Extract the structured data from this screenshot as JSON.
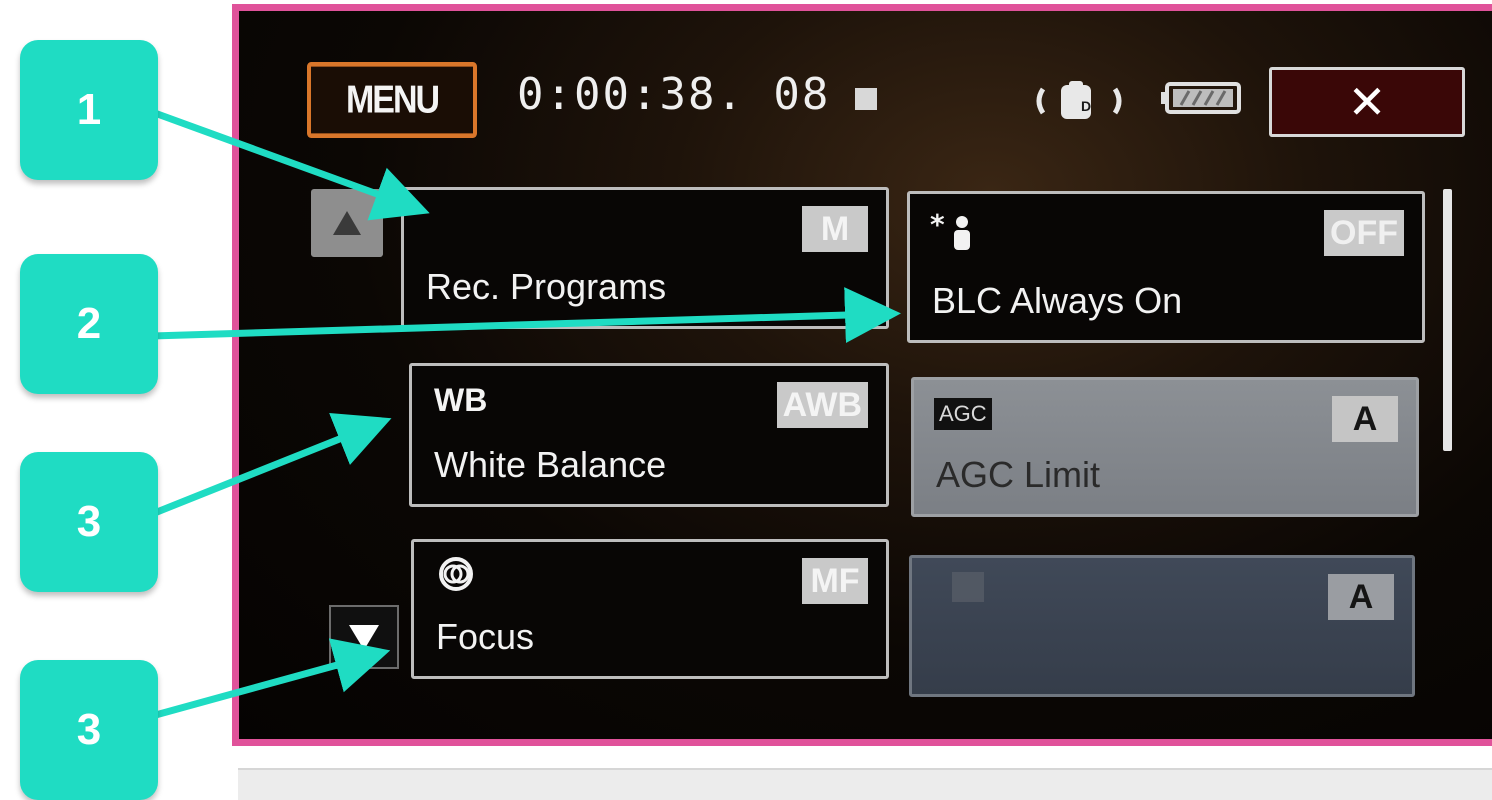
{
  "header": {
    "menu_label": "MENU",
    "timecode": "0:00:38. 08",
    "close_symbol": "✕"
  },
  "tiles": [
    {
      "label": "Rec. Programs",
      "badge": "M",
      "icon": ""
    },
    {
      "label": "BLC Always On",
      "badge": "OFF",
      "icon": "backlight-person-icon"
    },
    {
      "label": "White Balance",
      "badge": "AWB",
      "icon": "WB"
    },
    {
      "label": "AGC Limit",
      "badge": "A",
      "icon": "AGC"
    },
    {
      "label": "Focus",
      "badge": "MF",
      "icon": "focus-icon"
    },
    {
      "label": "",
      "badge": "A",
      "icon": "exposure-icon"
    }
  ],
  "callouts": [
    {
      "number": "1"
    },
    {
      "number": "2"
    },
    {
      "number": "3"
    },
    {
      "number": "3"
    }
  ],
  "colors": {
    "callout": "#1fdcc3",
    "frame": "#e0529a",
    "menu_border": "#d9762a"
  }
}
